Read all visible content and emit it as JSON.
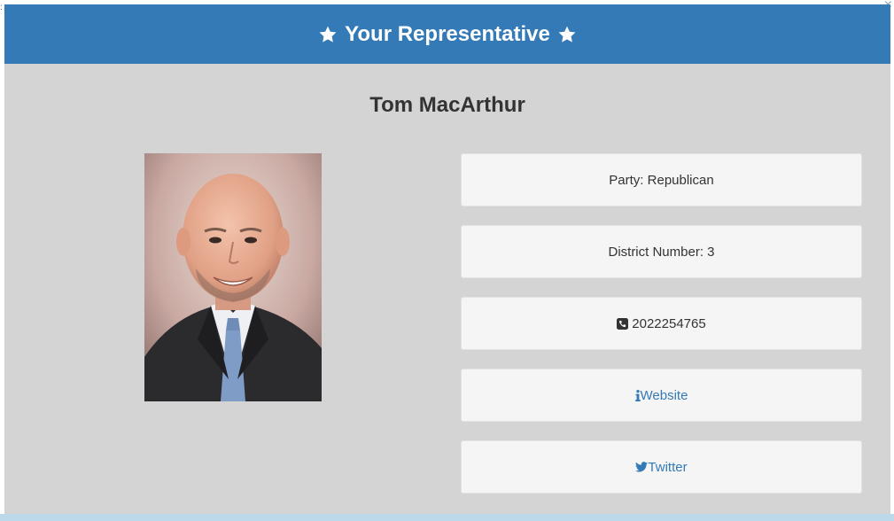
{
  "modal": {
    "title": "Your Representative",
    "icon_left": "star-icon",
    "icon_right": "star-icon",
    "header_color": "#337ab7"
  },
  "representative": {
    "name": "Tom MacArthur",
    "party": "Party: Republican",
    "district": "District Number: 3",
    "phone": "2022254765",
    "phone_icon": "phone-square-icon",
    "website_label": "Website",
    "website_icon": "info-icon",
    "twitter_label": "Twitter",
    "twitter_icon": "twitter-bird-icon"
  },
  "window": {
    "close_icon": "close-icon",
    "close_glyph": "×"
  }
}
